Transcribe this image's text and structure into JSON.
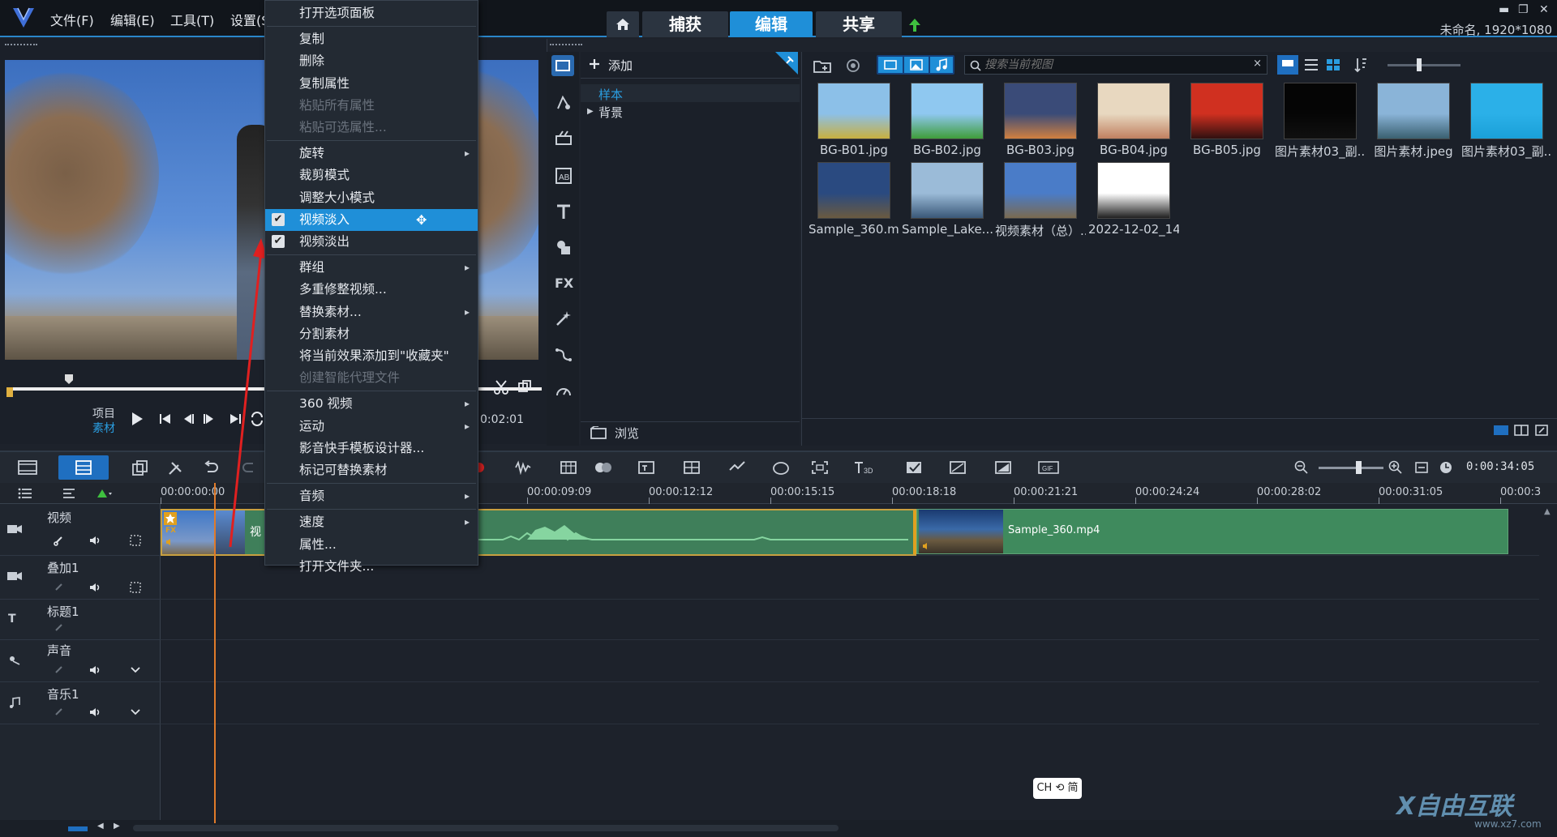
{
  "menubar": {
    "items": [
      "文件(F)",
      "编辑(E)",
      "工具(T)",
      "设置(S)"
    ]
  },
  "modes": {
    "capture": "捕获",
    "edit": "编辑",
    "share": "共享"
  },
  "window": {
    "project_title": "未命名, 1920*1080",
    "minimize": "▬",
    "restore": "❐",
    "close": "✕"
  },
  "preview": {
    "project_label": "项目",
    "clip_label": "素材",
    "timecode": "0:02:01"
  },
  "library": {
    "add_label": "添加",
    "tree": [
      "样本",
      "背景"
    ],
    "browse_label": "浏览",
    "search_placeholder": "搜索当前视图",
    "items": [
      {
        "label": "BG-B01.jpg",
        "colors": [
          "#8cc0e8",
          "#c8b040"
        ]
      },
      {
        "label": "BG-B02.jpg",
        "colors": [
          "#8fc8f0",
          "#3f9d3a"
        ]
      },
      {
        "label": "BG-B03.jpg",
        "colors": [
          "#3a4b78",
          "#d08040"
        ]
      },
      {
        "label": "BG-B04.jpg",
        "colors": [
          "#e8d8c0",
          "#c08060"
        ]
      },
      {
        "label": "BG-B05.jpg",
        "colors": [
          "#d03020",
          "#301010"
        ]
      },
      {
        "label": "图片素材03_副...",
        "colors": [
          "#050505",
          "#101010"
        ]
      },
      {
        "label": "图片素材.jpeg",
        "colors": [
          "#8ab4d8",
          "#3a6070"
        ]
      },
      {
        "label": "图片素材03_副...",
        "colors": [
          "#2bb0e8",
          "#1aa0d8"
        ]
      },
      {
        "label": "Sample_360.m...",
        "colors": [
          "#2a4a80",
          "#6a5a40"
        ]
      },
      {
        "label": "Sample_Lake....",
        "colors": [
          "#9bbbd8",
          "#3a5878"
        ]
      },
      {
        "label": "视频素材（总）....",
        "colors": [
          "#4a7cc8",
          "#7a6a50"
        ]
      },
      {
        "label": "2022-12-02_14...",
        "colors": [
          "#ffffff",
          "#202020"
        ]
      }
    ]
  },
  "timeline": {
    "ticks": [
      "00:00:00:00",
      "00:00:09:09",
      "00:00:12:12",
      "00:00:15:15",
      "00:00:18:18",
      "00:00:21:21",
      "00:00:24:24",
      "00:00:28:02",
      "00:00:31:05",
      "00:00:3"
    ],
    "duration": "0:00:34:05",
    "tracks": [
      "视频",
      "叠加1",
      "标题1",
      "声音",
      "音乐1"
    ],
    "clip_main_label": "视",
    "clip_360_label": "Sample_360.mp4"
  },
  "context_menu": {
    "items": [
      {
        "label": "打开选项面板",
        "disabled": false
      },
      {
        "sep": true
      },
      {
        "label": "复制",
        "disabled": false
      },
      {
        "label": "删除",
        "disabled": false
      },
      {
        "label": "复制属性",
        "disabled": false
      },
      {
        "label": "粘贴所有属性",
        "disabled": true
      },
      {
        "label": "粘贴可选属性...",
        "disabled": true
      },
      {
        "sep": true
      },
      {
        "label": "旋转",
        "submenu": true
      },
      {
        "label": "裁剪模式"
      },
      {
        "label": "调整大小模式"
      },
      {
        "label": "视频淡入",
        "checked": true,
        "highlighted": true
      },
      {
        "label": "视频淡出",
        "checked": true
      },
      {
        "sep": true
      },
      {
        "label": "群组",
        "submenu": true
      },
      {
        "label": "多重修整视频..."
      },
      {
        "label": "替换素材...",
        "submenu": true
      },
      {
        "label": "分割素材"
      },
      {
        "label": "将当前效果添加到\"收藏夹\""
      },
      {
        "label": "创建智能代理文件",
        "disabled": true
      },
      {
        "sep": true
      },
      {
        "label": "360 视频",
        "submenu": true
      },
      {
        "label": "运动",
        "submenu": true
      },
      {
        "label": "影音快手模板设计器..."
      },
      {
        "label": "标记可替换素材"
      },
      {
        "sep": true
      },
      {
        "label": "音频",
        "submenu": true
      },
      {
        "sep": true
      },
      {
        "label": "速度",
        "submenu": true
      },
      {
        "label": "属性..."
      },
      {
        "label": "打开文件夹..."
      }
    ]
  },
  "ime": "CH ⟲ 简",
  "watermark": {
    "text": "X自由互联",
    "url": "www.xz7.com"
  },
  "colors": {
    "accent": "#1f8fd8",
    "playhead": "#e07b2a",
    "clip": "#3f7f5a"
  }
}
